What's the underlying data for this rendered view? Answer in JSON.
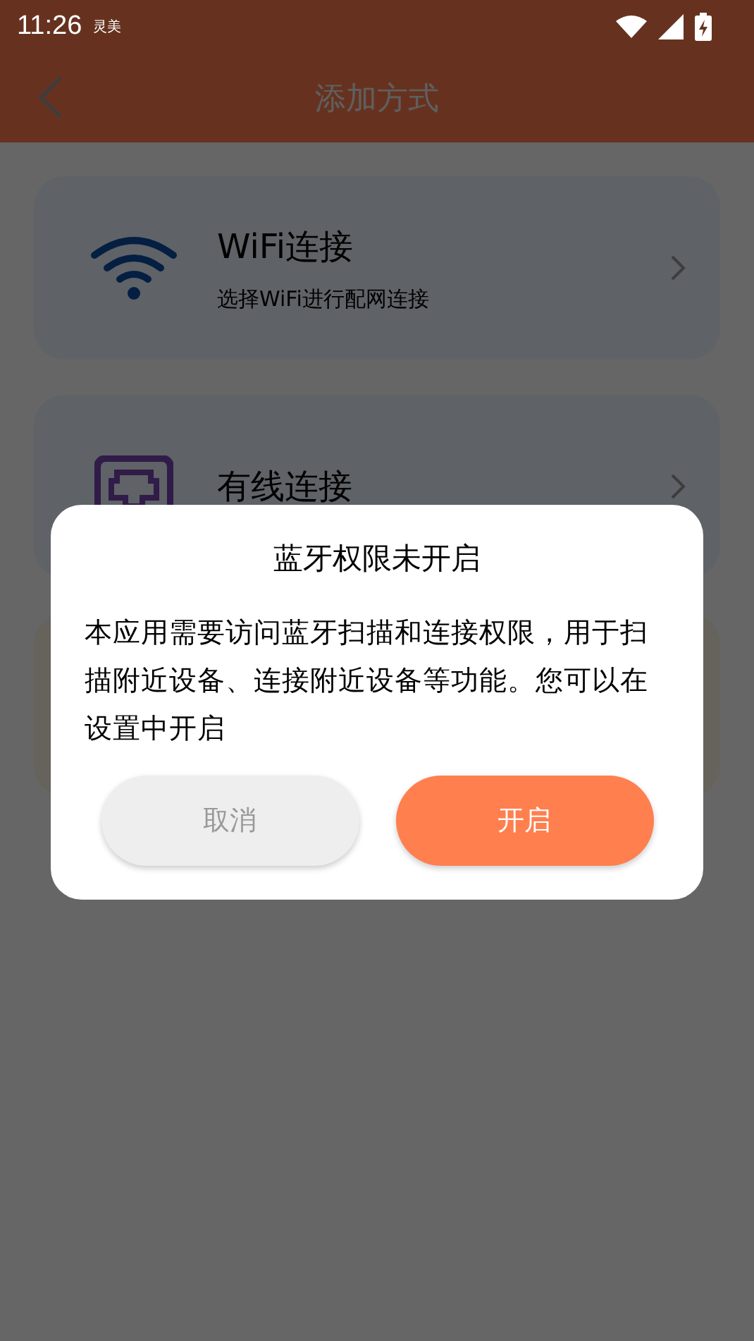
{
  "status_bar": {
    "time": "11:26",
    "notification": "灵美"
  },
  "header": {
    "title": "添加方式"
  },
  "methods": [
    {
      "kind": "wifi",
      "title": "WiFi连接",
      "subtitle": "选择WiFi进行配网连接"
    },
    {
      "kind": "wired",
      "title": "有线连接"
    },
    {
      "kind": "blank"
    }
  ],
  "dialog": {
    "title": "蓝牙权限未开启",
    "message": "本应用需要访问蓝牙扫描和连接权限，用于扫描附近设备、连接附近设备等功能。您可以在设置中开启",
    "buttons": [
      {
        "label": "取消",
        "kind": "cancel"
      },
      {
        "label": "开启",
        "kind": "confirm"
      }
    ]
  }
}
